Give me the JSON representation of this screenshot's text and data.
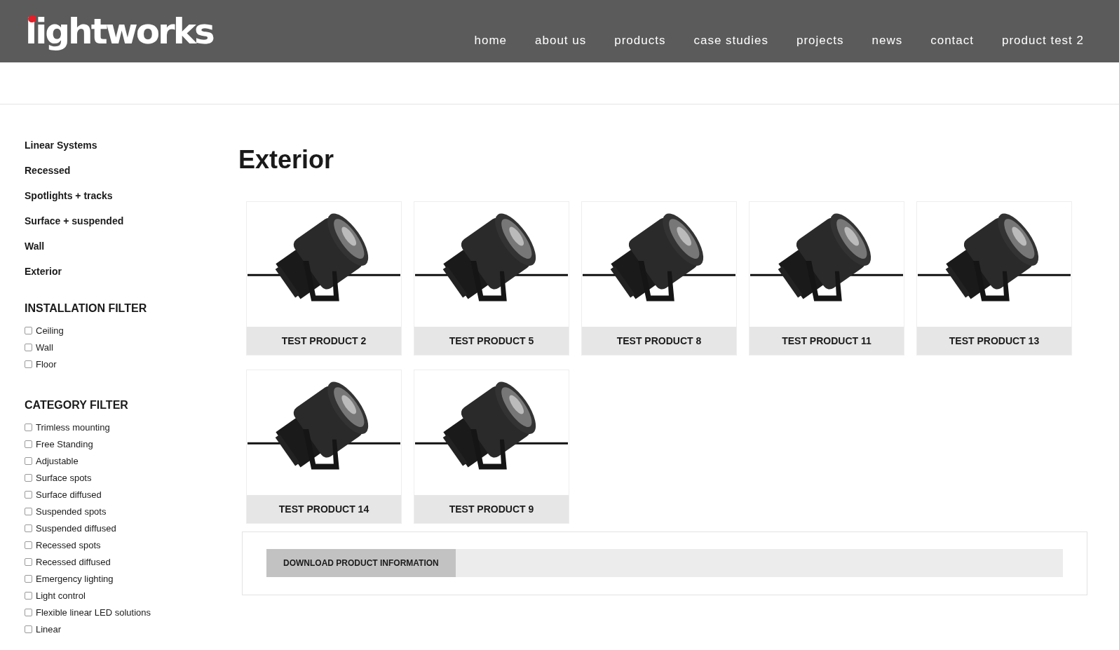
{
  "header": {
    "logo": "lightworks",
    "nav": [
      {
        "label": "home"
      },
      {
        "label": "about us"
      },
      {
        "label": "products"
      },
      {
        "label": "case studies"
      },
      {
        "label": "projects"
      },
      {
        "label": "news"
      },
      {
        "label": "contact"
      },
      {
        "label": "product test 2"
      }
    ]
  },
  "sidebar": {
    "categories": [
      "Linear Systems",
      "Recessed",
      "Spotlights + tracks",
      "Surface + suspended",
      "Wall",
      "Exterior"
    ],
    "filters": [
      {
        "title": "INSTALLATION FILTER",
        "options": [
          {
            "label": "Ceiling",
            "checked": false
          },
          {
            "label": "Wall",
            "checked": false
          },
          {
            "label": "Floor",
            "checked": false
          }
        ]
      },
      {
        "title": "CATEGORY FILTER",
        "options": [
          {
            "label": "Trimless mounting",
            "checked": false
          },
          {
            "label": "Free Standing",
            "checked": false
          },
          {
            "label": "Adjustable",
            "checked": false
          },
          {
            "label": "Surface spots",
            "checked": false
          },
          {
            "label": "Surface diffused",
            "checked": false
          },
          {
            "label": "Suspended spots",
            "checked": false
          },
          {
            "label": "Suspended diffused",
            "checked": false
          },
          {
            "label": "Recessed spots",
            "checked": false
          },
          {
            "label": "Recessed diffused",
            "checked": false
          },
          {
            "label": "Emergency lighting",
            "checked": false
          },
          {
            "label": "Light control",
            "checked": false
          },
          {
            "label": "Flexible linear LED solutions",
            "checked": false
          },
          {
            "label": "Linear",
            "checked": false
          }
        ]
      }
    ]
  },
  "main": {
    "title": "Exterior",
    "products": [
      {
        "name": "TEST PRODUCT 2"
      },
      {
        "name": "TEST PRODUCT 5"
      },
      {
        "name": "TEST PRODUCT 8"
      },
      {
        "name": "TEST PRODUCT 11"
      },
      {
        "name": "TEST PRODUCT 13"
      },
      {
        "name": "TEST PRODUCT 14"
      },
      {
        "name": "TEST PRODUCT 9"
      }
    ],
    "download_button": "DOWNLOAD PRODUCT INFORMATION"
  }
}
